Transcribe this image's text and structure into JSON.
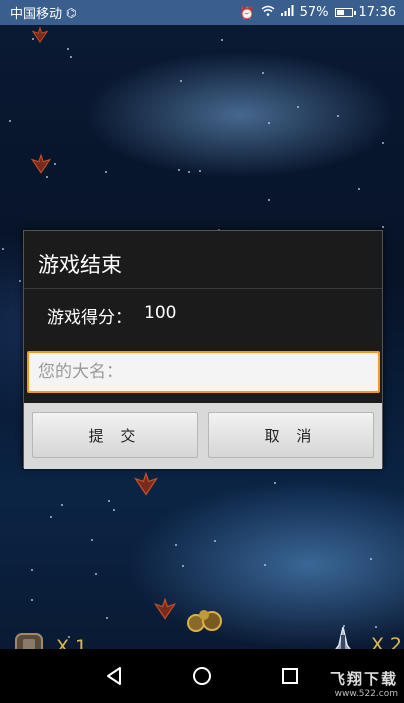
{
  "status_bar": {
    "carrier": "中国移动",
    "battery": "57%",
    "battery_level": 0.57,
    "time": "17:36",
    "icons": [
      "data-icon",
      "alarm-icon",
      "wifi-icon",
      "signal-icon",
      "battery-icon"
    ]
  },
  "dialog": {
    "title": "游戏结束",
    "score_label": "游戏得分：",
    "score_value": "100",
    "name_placeholder": "您的大名：",
    "name_value": "",
    "submit_label": "提 交",
    "cancel_label": "取 消"
  },
  "hud": {
    "bombs_count": "X 1",
    "lives_count": "X 2"
  },
  "nav": {
    "icons": [
      "back-icon",
      "home-icon",
      "recents-icon"
    ]
  },
  "watermark": {
    "title": "飞翔下载",
    "url": "www.522.com"
  },
  "colors": {
    "status_bar": "#3a5f8f",
    "input_border": "#f39a1e",
    "hud_text": "#e0b84a"
  }
}
